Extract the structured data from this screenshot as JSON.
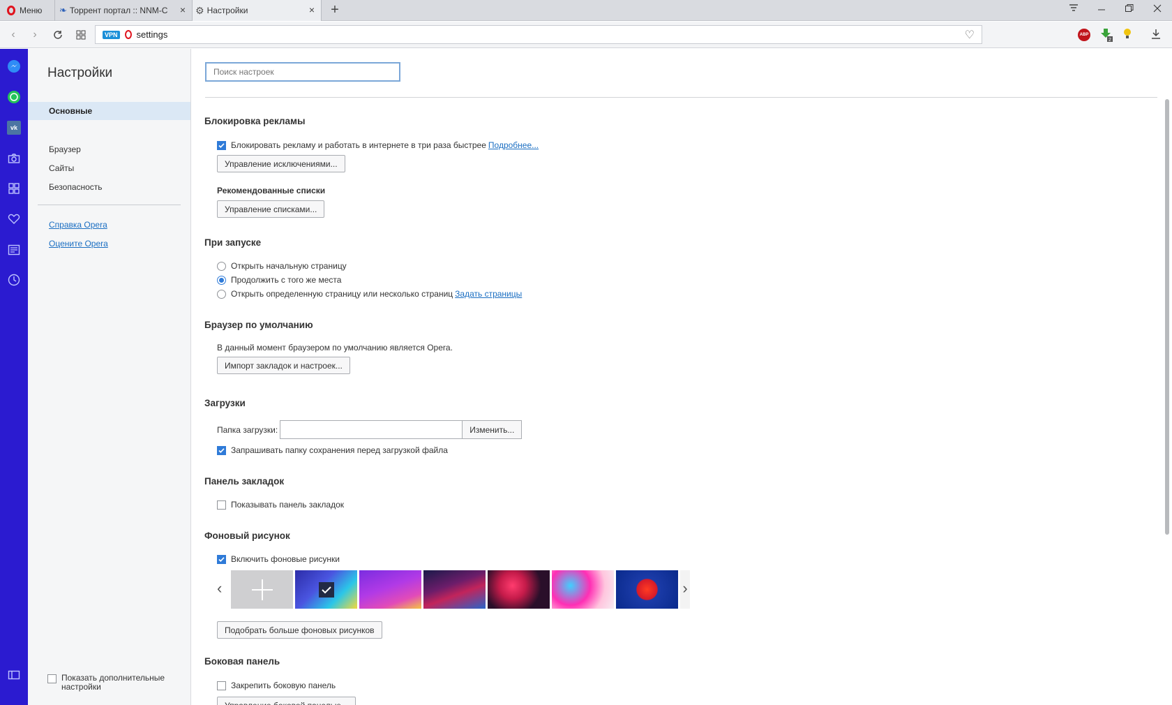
{
  "tabbar": {
    "menu_label": "Меню",
    "tabs": [
      {
        "title": "Торрент портал :: NNM-C"
      },
      {
        "title": "Настройки"
      }
    ]
  },
  "address": {
    "vpn_badge": "VPN",
    "url": "settings"
  },
  "leftnav": {
    "title": "Настройки",
    "items": [
      "Основные",
      "Браузер",
      "Сайты",
      "Безопасность"
    ],
    "links": [
      "Справка Opera",
      "Оцените Opera"
    ],
    "advanced_label_1": "Показать дополнительные",
    "advanced_label_2": "настройки"
  },
  "search": {
    "placeholder": "Поиск настроек"
  },
  "sections": {
    "adblock": {
      "title": "Блокировка рекламы",
      "checkbox": "Блокировать рекламу и работать в интернете в три раза быстрее",
      "more_link": "Подробнее...",
      "manage_exceptions": "Управление исключениями...",
      "recommended_lists": "Рекомендованные списки",
      "manage_lists": "Управление списками..."
    },
    "startup": {
      "title": "При запуске",
      "option1": "Открыть начальную страницу",
      "option2": "Продолжить с того же места",
      "option3": "Открыть определенную страницу или несколько страниц",
      "set_pages_link": "Задать страницы",
      "selected": 2
    },
    "default_browser": {
      "title": "Браузер по умолчанию",
      "status": "В данный момент браузером по умолчанию является Opera.",
      "import_button": "Импорт закладок и настроек..."
    },
    "downloads": {
      "title": "Загрузки",
      "folder_label": "Папка загрузки:",
      "folder_value": "",
      "change_button": "Изменить...",
      "ask_checkbox": "Запрашивать папку сохранения перед загрузкой файла"
    },
    "bookmarks_bar": {
      "title": "Панель закладок",
      "checkbox": "Показывать панель закладок"
    },
    "wallpaper": {
      "title": "Фоновый рисунок",
      "checkbox": "Включить фоновые рисунки",
      "more_button": "Подобрать больше фоновых рисунков"
    },
    "side_panel": {
      "title": "Боковая панель",
      "checkbox": "Закрепить боковую панель",
      "manage_button": "Управление боковой панелью..."
    }
  },
  "colors": {
    "sidebar": "#2b1bd0",
    "accent": "#2f7bd8",
    "link": "#1a6ec2"
  }
}
